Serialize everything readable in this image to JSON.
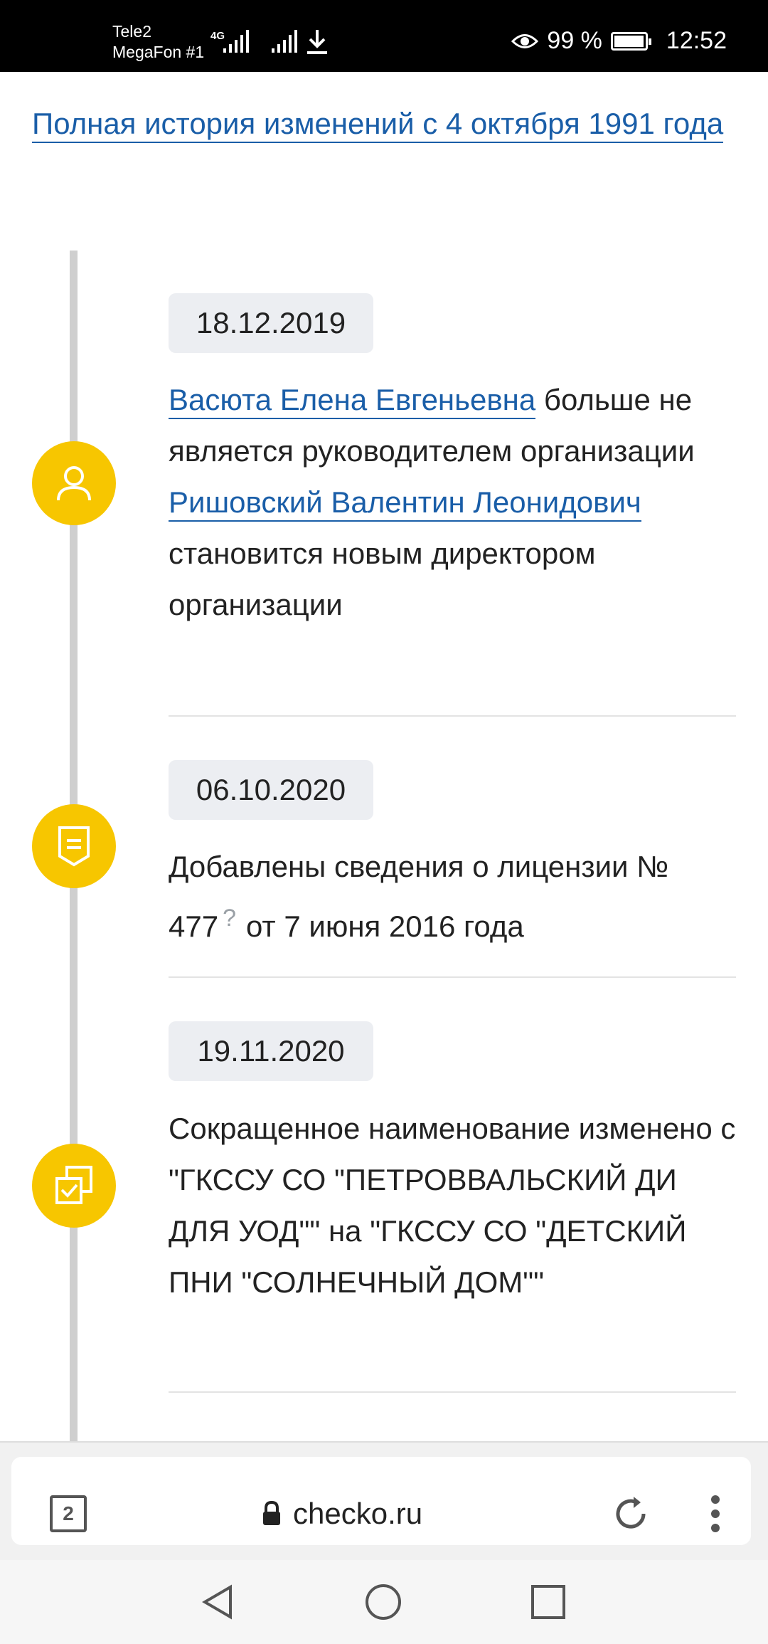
{
  "status_bar": {
    "carrier1": "Tele2",
    "carrier2": "MegaFon #1",
    "network_type": "4G",
    "battery_percent": "99 %",
    "battery_level": 0.99,
    "time": "12:52",
    "icons": [
      "signal-icon",
      "download-icon",
      "eye-icon",
      "battery-icon"
    ]
  },
  "page": {
    "history_link": "Полная история изменений с 4 октября 1991 года"
  },
  "events": [
    {
      "date": "18.12.2019",
      "icon": "person-icon",
      "person1": "Васюта Елена Евгеньевна",
      "text1a": " больше не является руководителем организации",
      "person2": "Ришовский Валентин Леонидович",
      "text2": " становится новым директором организации"
    },
    {
      "date": "06.10.2020",
      "icon": "license-icon",
      "text": "Добавлены сведения о лицензии № 477",
      "help": "?",
      "text_after": "от 7 июня 2016 года"
    },
    {
      "date": "19.11.2020",
      "icon": "copy-check-icon",
      "text": "Сокращенное наименование изменено с \"ГКССУ СО \"ПЕТРОВВАЛЬСКИЙ ДИ ДЛЯ УОД\"\" на \"ГКССУ СО \"ДЕТСКИЙ ПНИ \"СОЛНЕЧНЫЙ ДОМ\"\""
    }
  ],
  "browser": {
    "tab_count": "2",
    "url": "checko.ru",
    "icons": [
      "lock-icon",
      "refresh-icon",
      "menu-dots-icon"
    ]
  },
  "nav": {
    "icons": [
      "back-icon",
      "home-icon",
      "recents-icon"
    ]
  }
}
